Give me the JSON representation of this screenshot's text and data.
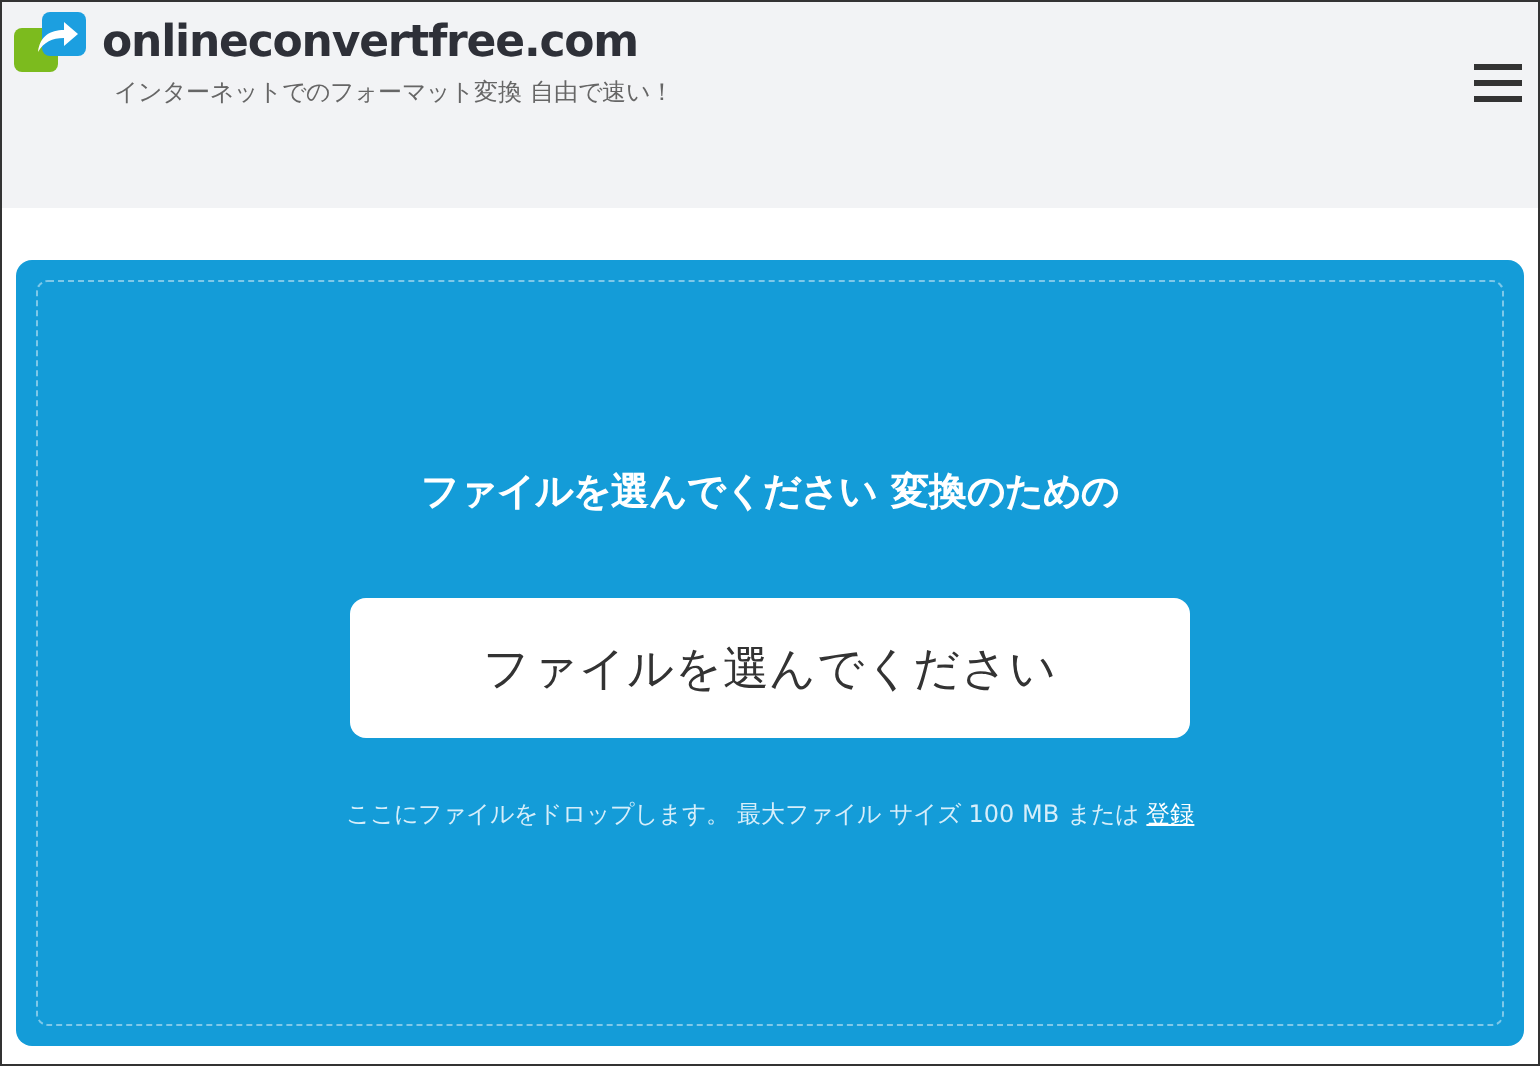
{
  "header": {
    "logo_text": "onlineconvertfree.com",
    "tagline": "インターネットでのフォーマット変換 自由で速い！"
  },
  "upload": {
    "heading": "ファイルを選んでください 変換のための",
    "button": "ファイルを選んでください",
    "hint": "ここにファイルをドロップします。 最大ファイル サイズ 100 MB または",
    "link": "登録"
  }
}
